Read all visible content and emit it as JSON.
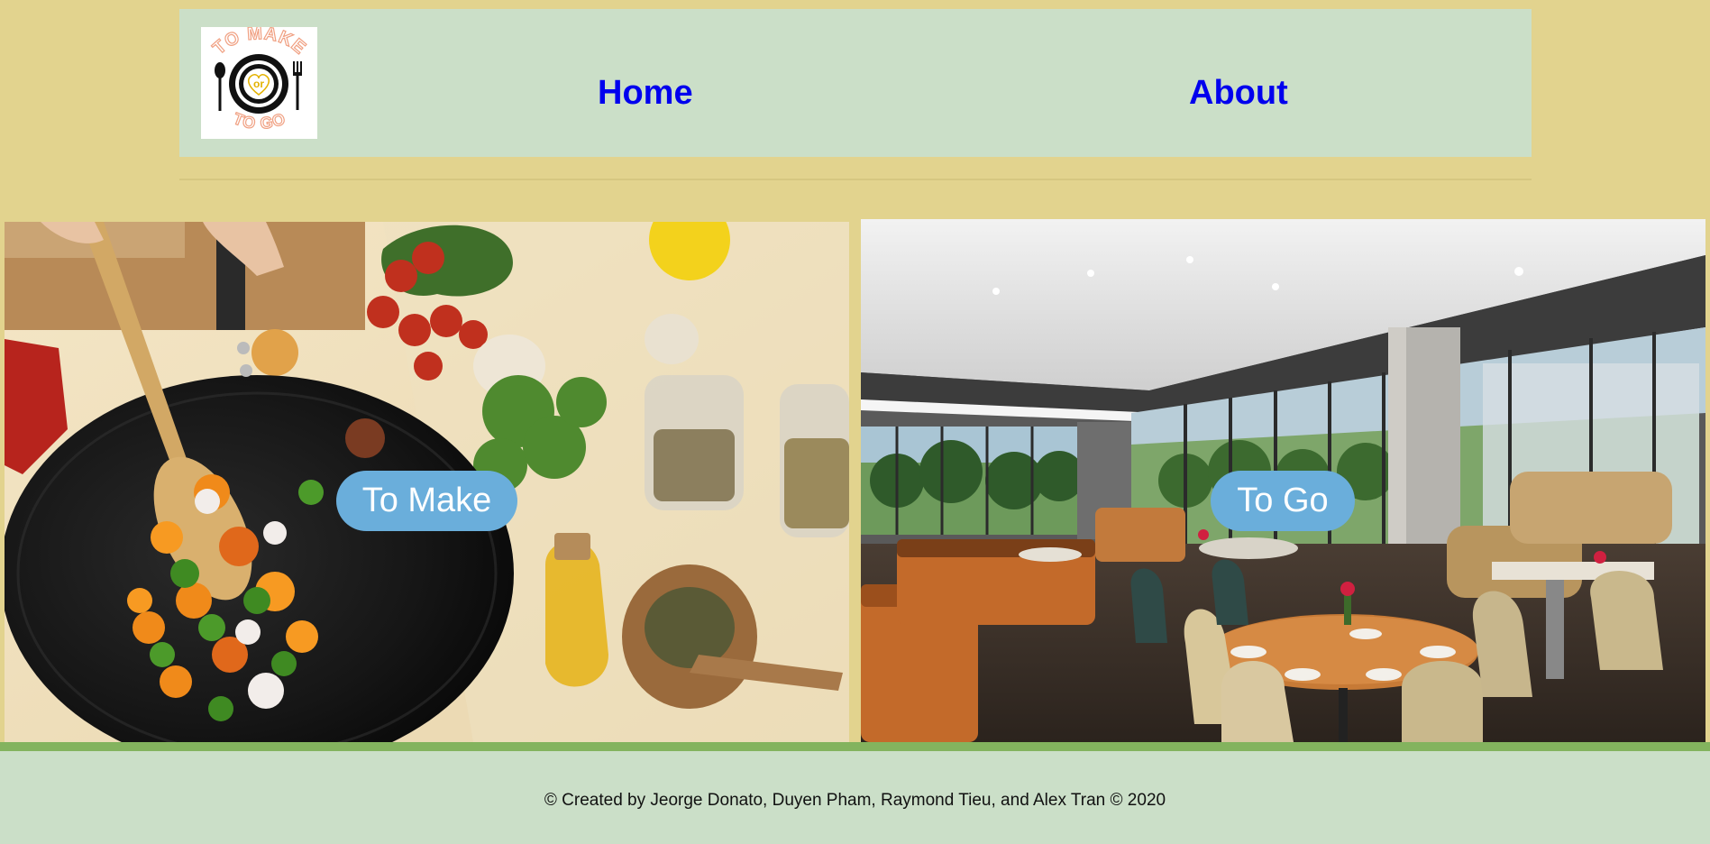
{
  "header": {
    "logo": {
      "top_text": "TO MAKE",
      "middle_text": "or",
      "bottom_text": "TO GO",
      "icon": "plate-fork-spoon-heart-logo"
    },
    "nav": [
      {
        "label": "Home"
      },
      {
        "label": "About"
      }
    ]
  },
  "main": {
    "panels": [
      {
        "image": "cooking-wok-vegetables-photo",
        "button_label": "To Make"
      },
      {
        "image": "restaurant-dining-room-photo",
        "button_label": "To Go"
      }
    ]
  },
  "footer": {
    "text": "© Created by Jeorge Donato, Duyen Pham, Raymond Tieu, and Alex Tran © 2020"
  },
  "colors": {
    "page_bg": "#e2d38e",
    "header_bg": "#cbdfc8",
    "link": "#0000ee",
    "button_bg": "#6aaedb",
    "footer_bar": "#83b35e",
    "footer_bg": "#cbdfc8"
  }
}
